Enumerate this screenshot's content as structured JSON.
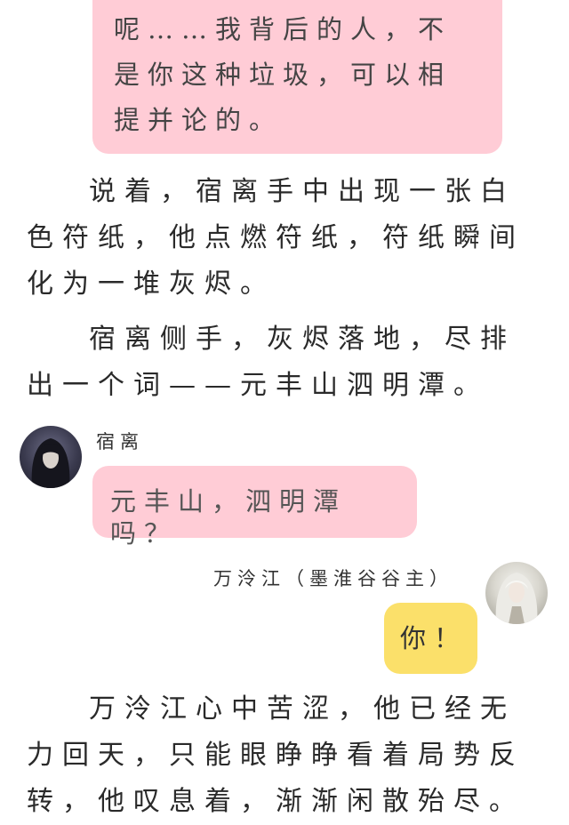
{
  "messages": {
    "top_bubble": "呢……我背后的人，不是你这种垃圾，可以相提并论的。",
    "suli_name": "宿离",
    "suli_bubble": "元丰山，泗明潭吗？",
    "wan_name": "万泠江（墨淮谷谷主）",
    "wan_bubble": "你！"
  },
  "narration": {
    "p1": "说着，宿离手中出现一张白色符纸，他点燃符纸，符纸瞬间化为一堆灰烬。",
    "p2": "宿离侧手，灰烬落地，尽排出一个词——元丰山泗明潭。",
    "p3": "万泠江心中苦涩，他已经无力回天，只能眼睁睁看着局势反转，他叹息着，渐渐闲散殆尽。"
  },
  "colors": {
    "pink_bubble": "#ffccd6",
    "yellow_bubble": "#fbe06a"
  }
}
